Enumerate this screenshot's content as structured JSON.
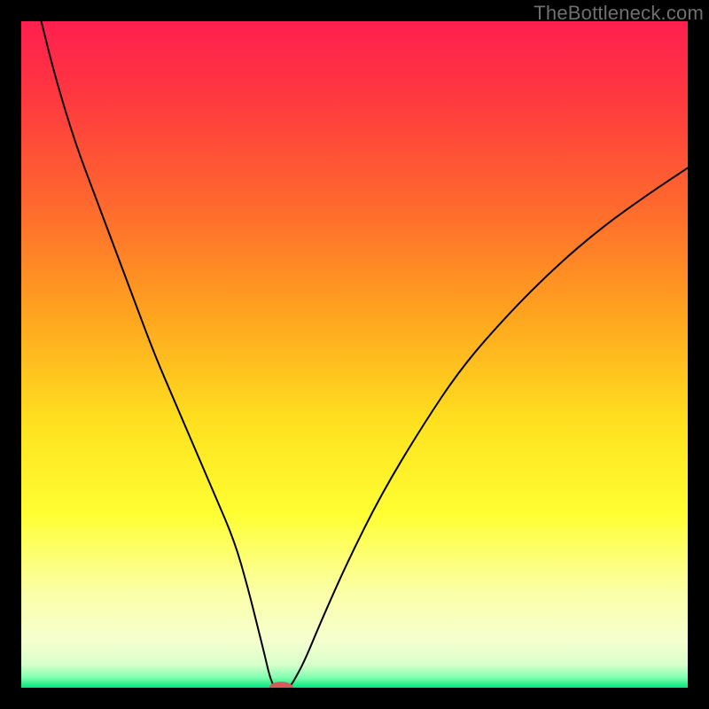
{
  "watermark": "TheBottleneck.com",
  "chart_data": {
    "type": "line",
    "title": "",
    "xlabel": "",
    "ylabel": "",
    "xlim": [
      0,
      100
    ],
    "ylim": [
      0,
      100
    ],
    "grid": false,
    "legend": false,
    "gradient_stops": [
      {
        "offset": 0.0,
        "color": "#ff1f4f"
      },
      {
        "offset": 0.12,
        "color": "#ff3a3f"
      },
      {
        "offset": 0.28,
        "color": "#ff6a2e"
      },
      {
        "offset": 0.44,
        "color": "#ffa41f"
      },
      {
        "offset": 0.6,
        "color": "#ffe01f"
      },
      {
        "offset": 0.74,
        "color": "#ffff33"
      },
      {
        "offset": 0.86,
        "color": "#fbffaa"
      },
      {
        "offset": 0.93,
        "color": "#f5ffcf"
      },
      {
        "offset": 0.965,
        "color": "#d8ffca"
      },
      {
        "offset": 0.985,
        "color": "#7fffb0"
      },
      {
        "offset": 1.0,
        "color": "#00e57a"
      }
    ],
    "series": [
      {
        "name": "left_branch",
        "color": "#000000",
        "x": [
          3,
          5,
          8,
          11,
          14,
          17,
          20,
          23,
          26,
          29,
          32,
          34,
          35.5,
          36.5,
          37.2,
          37.7,
          38
        ],
        "y": [
          100,
          92,
          82,
          74,
          66,
          58,
          50,
          43,
          36,
          29,
          22,
          15,
          9,
          5,
          2,
          0.6,
          0
        ]
      },
      {
        "name": "right_branch",
        "color": "#000000",
        "x": [
          40.2,
          41,
          42.5,
          45,
          49,
          54,
          60,
          66,
          73,
          80,
          87,
          94,
          100
        ],
        "y": [
          0,
          1.2,
          4,
          10,
          19,
          29,
          39,
          48,
          56,
          63,
          69,
          74,
          78
        ]
      }
    ],
    "marker": {
      "cx": 39.0,
      "cy": 0.0,
      "rx_frac": 0.018,
      "ry_frac": 0.009,
      "color": "#d65a5c"
    }
  }
}
